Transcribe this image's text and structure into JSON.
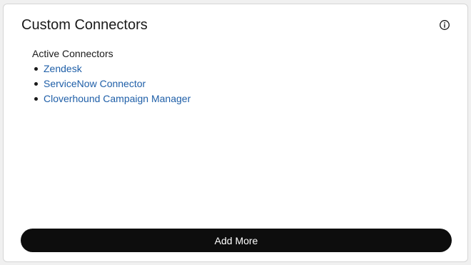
{
  "card": {
    "title": "Custom Connectors",
    "info_icon": "info-circle-icon"
  },
  "active_connectors": {
    "label": "Active Connectors",
    "items": [
      {
        "label": "Zendesk"
      },
      {
        "label": "ServiceNow Connector"
      },
      {
        "label": "Cloverhound Campaign Manager"
      }
    ]
  },
  "actions": {
    "add_more_label": "Add More"
  },
  "colors": {
    "link": "#1f5fa8",
    "button_bg": "#0d0d0d",
    "button_text": "#ffffff",
    "card_border": "#d6d6d6"
  }
}
